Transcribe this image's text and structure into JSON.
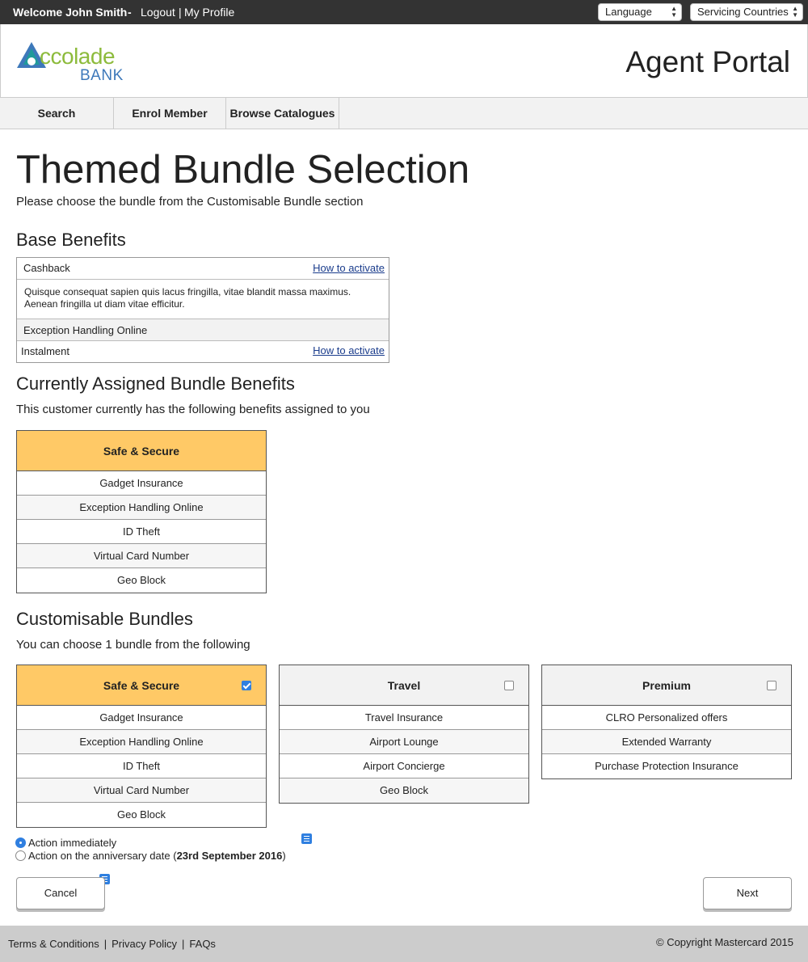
{
  "topbar": {
    "welcome": "Welcome John Smith",
    "dash": "-",
    "logout": "Logout",
    "separator": "|",
    "profile": "My Profile",
    "language": "Language",
    "countries": "Servicing Countries"
  },
  "header": {
    "logo_main": "ccolade",
    "logo_sub": "BANK",
    "portal_title": "Agent Portal"
  },
  "nav": [
    "Search",
    "Enrol Member",
    "Browse Catalogues"
  ],
  "page": {
    "title": "Themed Bundle Selection",
    "subtitle": "Please choose the bundle from the Customisable Bundle section"
  },
  "base_benefits": {
    "heading": "Base Benefits",
    "rows": [
      {
        "label": "Cashback",
        "link": "How to activate"
      },
      {
        "description": "Quisque consequat sapien quis lacus fringilla, vitae blandit massa maximus. Aenean fringilla ut diam vitae efficitur."
      },
      {
        "label": "Exception Handling Online"
      },
      {
        "label": "Instalment",
        "link": "How to activate"
      }
    ]
  },
  "assigned": {
    "heading": "Currently Assigned Bundle Benefits",
    "text": "This customer currently has the following benefits assigned to you",
    "bundle": {
      "name": "Safe & Secure",
      "items": [
        "Gadget Insurance",
        "Exception Handling Online",
        "ID Theft",
        "Virtual Card Number",
        "Geo Block"
      ]
    }
  },
  "custom": {
    "heading": "Customisable Bundles",
    "text": "You can choose 1 bundle from the following",
    "bundles": [
      {
        "name": "Safe & Secure",
        "checked": true,
        "items": [
          "Gadget Insurance",
          "Exception Handling Online",
          "ID Theft",
          "Virtual Card Number",
          "Geo Block"
        ]
      },
      {
        "name": "Travel",
        "checked": false,
        "items": [
          "Travel Insurance",
          "Airport Lounge",
          "Airport Concierge",
          "Geo Block"
        ]
      },
      {
        "name": "Premium",
        "checked": false,
        "items": [
          "CLRO Personalized offers",
          "Extended Warranty",
          "Purchase Protection Insurance"
        ]
      }
    ]
  },
  "action": {
    "option1": "Action immediately",
    "option2_prefix": "Action on the anniversary date (",
    "option2_date": "23rd September 2016",
    "option2_suffix": ")",
    "selected": "option1"
  },
  "buttons": {
    "cancel": "Cancel",
    "next": "Next"
  },
  "footer": {
    "links": [
      "Terms & Conditions",
      "Privacy Policy",
      "FAQs"
    ],
    "copyright": "© Copyright Mastercard 2015"
  },
  "colors": {
    "bundle_selected": "#ffc966",
    "topbar": "#333333",
    "accent_blue": "#2f7fe0"
  }
}
